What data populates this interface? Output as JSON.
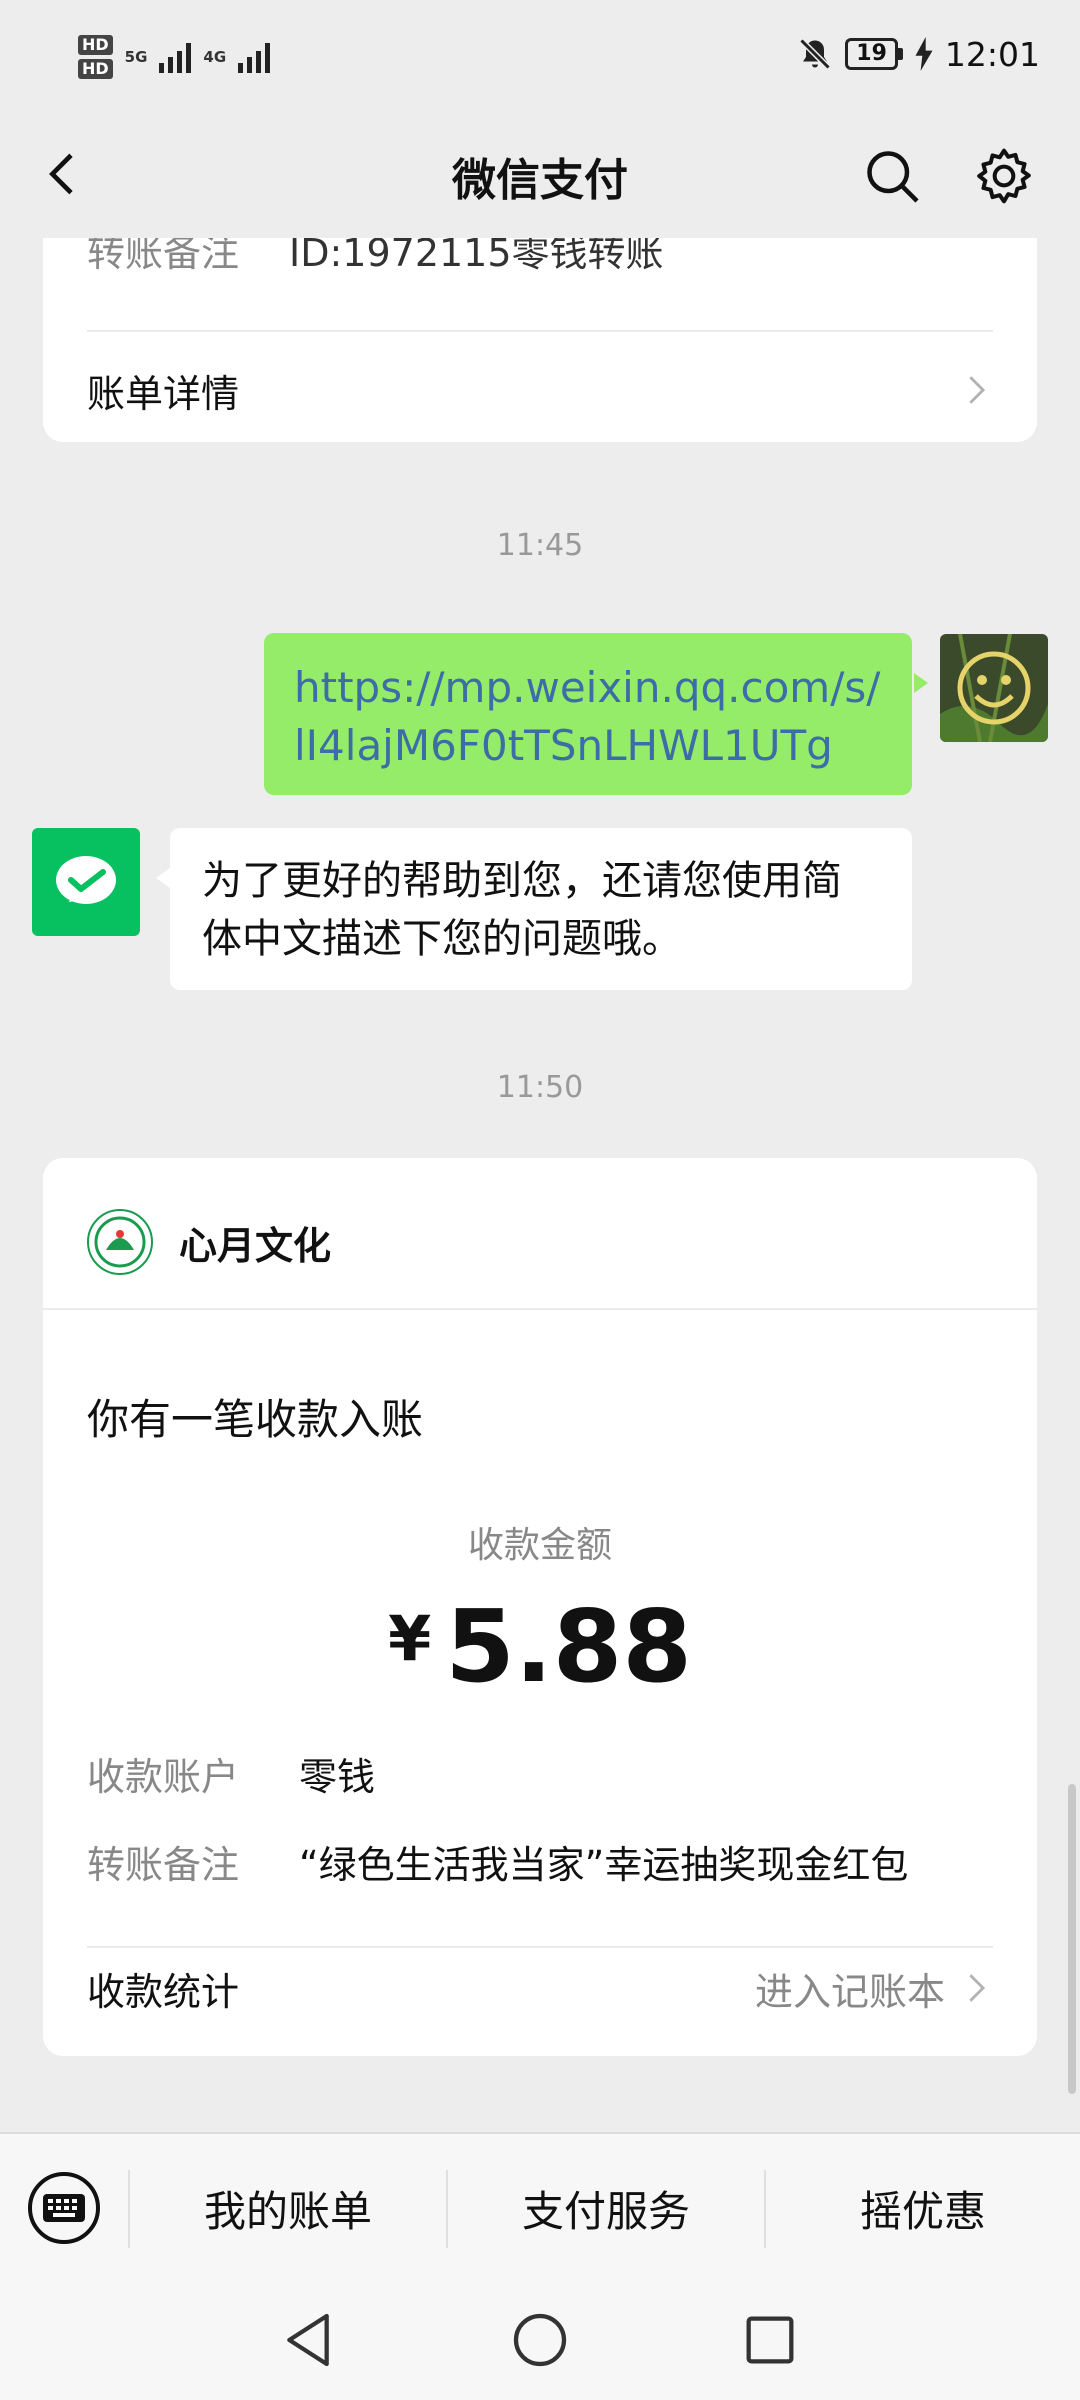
{
  "status_bar": {
    "hd1": "HD",
    "hd2": "HD",
    "net1": "5G",
    "net2": "4G",
    "battery": "19",
    "time": "12:01"
  },
  "header": {
    "title": "微信支付",
    "back_icon": "chevron-left-icon",
    "search_icon": "search-icon",
    "settings_icon": "gear-icon"
  },
  "prev_card": {
    "memo_label": "转账备注",
    "memo_value": "ID:1972115零钱转账",
    "bill_detail_label": "账单详情"
  },
  "chat": {
    "time1": "11:45",
    "user_message": "https://mp.weixin.qq.com/s/lI4lajM6F0tTSnLHWL1UTg",
    "bot_message": "为了更好的帮助到您，还请您使用简体中文描述下您的问题哦。",
    "time2": "11:50"
  },
  "payment_card": {
    "merchant_name": "心月文化",
    "heading": "你有一笔收款入账",
    "amount_label": "收款金额",
    "currency": "¥",
    "amount": "5.88",
    "account_label": "收款账户",
    "account_value": "零钱",
    "memo_label": "转账备注",
    "memo_value": "“绿色生活我当家”幸运抽奖现金红包",
    "stats_label": "收款统计",
    "stats_link": "进入记账本"
  },
  "bottom_menu": {
    "items": [
      "我的账单",
      "支付服务",
      "摇优惠"
    ]
  },
  "colors": {
    "background": "#ededed",
    "user_bubble": "#95ec69",
    "link_text": "#3d6da6",
    "wechat_green": "#07c160"
  }
}
